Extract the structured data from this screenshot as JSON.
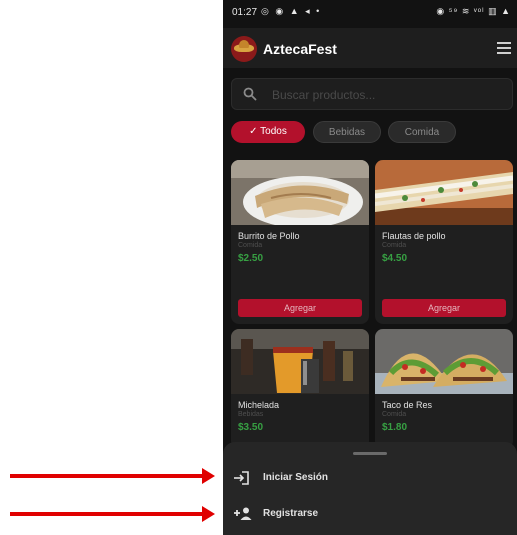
{
  "status_bar": {
    "time": "01:27",
    "left_icons": "◎ ◉ ▲ ◂ •",
    "right_icons": "◉ ⁵⁹ ≋ ᵛᵒˡ ▥ ▲"
  },
  "app": {
    "title": "AztecaFest",
    "brand_color": "#b3112c"
  },
  "search": {
    "placeholder": "Buscar productos..."
  },
  "categories": [
    {
      "label": "Todos",
      "selected": true,
      "check": "✓"
    },
    {
      "label": "Bebidas",
      "selected": false
    },
    {
      "label": "Comida",
      "selected": false
    }
  ],
  "products": [
    {
      "name": "Burrito de Pollo",
      "category": "Comida",
      "price": "$2.50",
      "button": "Agregar"
    },
    {
      "name": "Flautas de pollo",
      "category": "Comida",
      "price": "$4.50",
      "button": "Agregar"
    },
    {
      "name": "Michelada",
      "category": "Bebidas",
      "price": "$3.50"
    },
    {
      "name": "Taco de Res",
      "category": "Comida",
      "price": "$1.80"
    }
  ],
  "bottom_sheet": {
    "items": [
      {
        "label": "Iniciar Sesión",
        "icon": "login-icon"
      },
      {
        "label": "Registrarse",
        "icon": "person-add-icon"
      }
    ]
  }
}
